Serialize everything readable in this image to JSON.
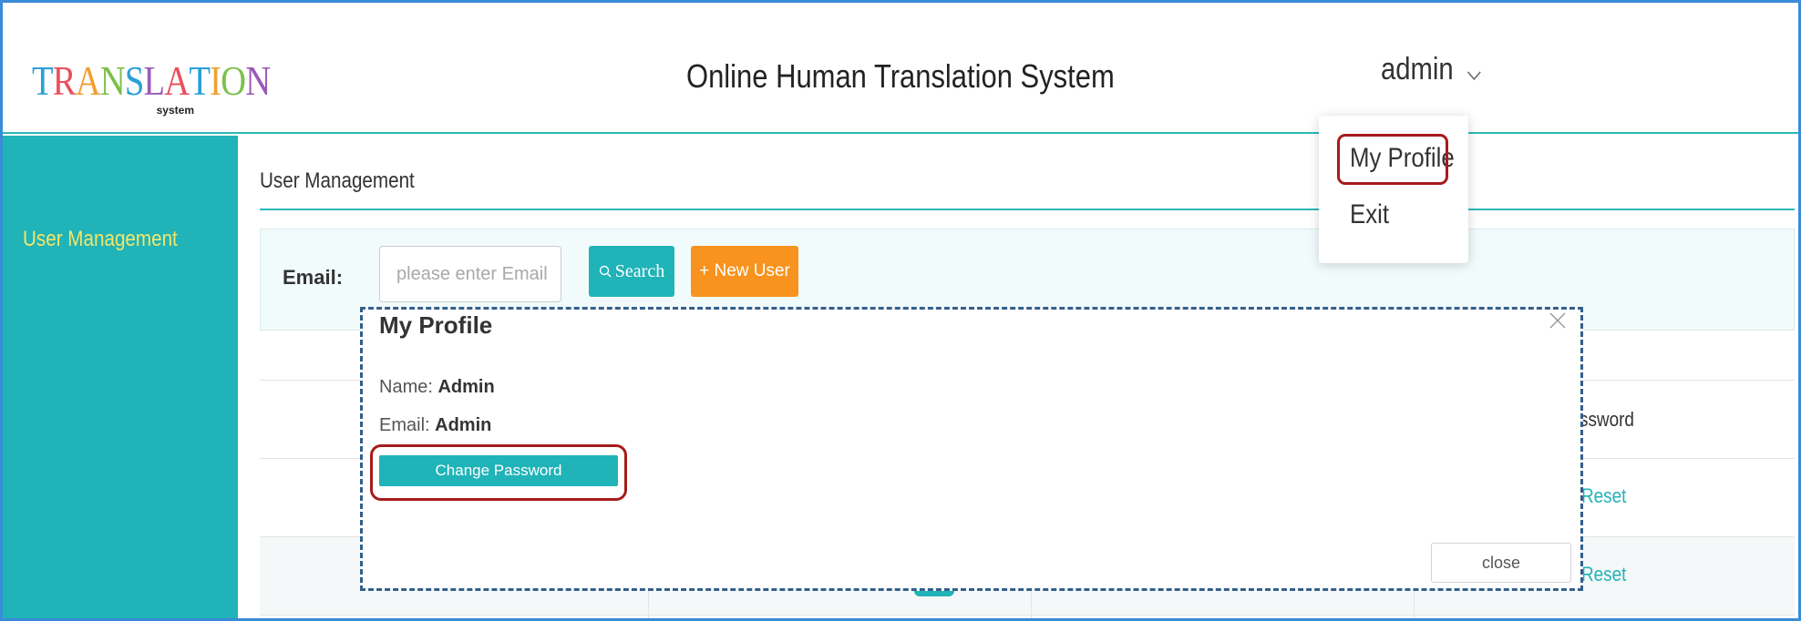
{
  "header": {
    "logo_text": "TRANSLATION",
    "logo_subtext": "system",
    "app_title": "Online Human Translation System",
    "user_name": "admin"
  },
  "sidebar": {
    "items": [
      {
        "label": "User Management"
      }
    ]
  },
  "main": {
    "title": "User Management",
    "filter": {
      "email_label": "Email:",
      "email_placeholder": "please enter Email",
      "search_label": "Search",
      "new_user_label": "+ New User"
    },
    "table": {
      "visible_header_fragment": "ssword",
      "rows": [
        {
          "action": "Reset"
        },
        {
          "action": "Reset"
        }
      ]
    }
  },
  "user_dropdown": {
    "items": [
      "My Profile",
      "Exit"
    ]
  },
  "profile_modal": {
    "title": "My Profile",
    "name_label": "Name:",
    "name_value": "Admin",
    "email_label": "Email:",
    "email_value": "Admin",
    "change_password_label": "Change Password",
    "close_label": "close"
  },
  "colors": {
    "accent": "#20b3b7",
    "sidebar_text": "#f2e56a",
    "new_user_button": "#f7931e",
    "highlight": "#a51c1c",
    "modal_border": "#345f8c",
    "frame_border": "#3a8bd8"
  },
  "icons": {
    "user_menu": "chevron-down-icon",
    "search_button": "search-icon",
    "modal_close": "close-icon"
  }
}
